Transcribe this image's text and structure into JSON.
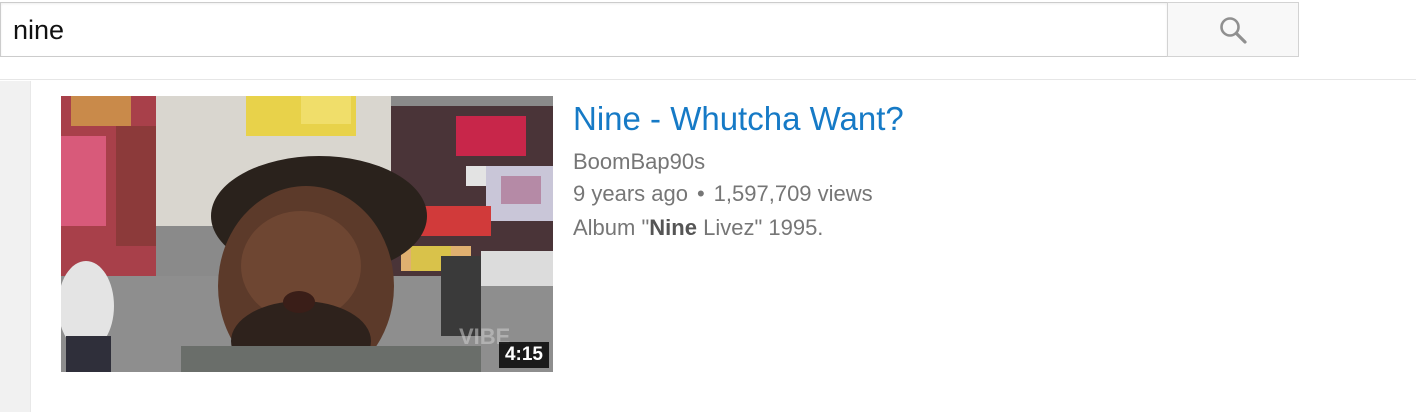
{
  "search": {
    "query": "nine",
    "button_icon": "search-icon"
  },
  "result": {
    "title": "Nine - Whutcha Want?",
    "channel": "BoomBap90s",
    "age": "9 years ago",
    "separator": "•",
    "views": "1,597,709 views",
    "description": {
      "prefix": "Album \"",
      "highlight": "Nine",
      "suffix": " Livez\" 1995."
    },
    "duration": "4:15",
    "thumbnail_watermark": "VIBE"
  },
  "colors": {
    "link": "#167ac6",
    "meta_text": "#767676",
    "search_button_bg": "#f8f8f8"
  }
}
